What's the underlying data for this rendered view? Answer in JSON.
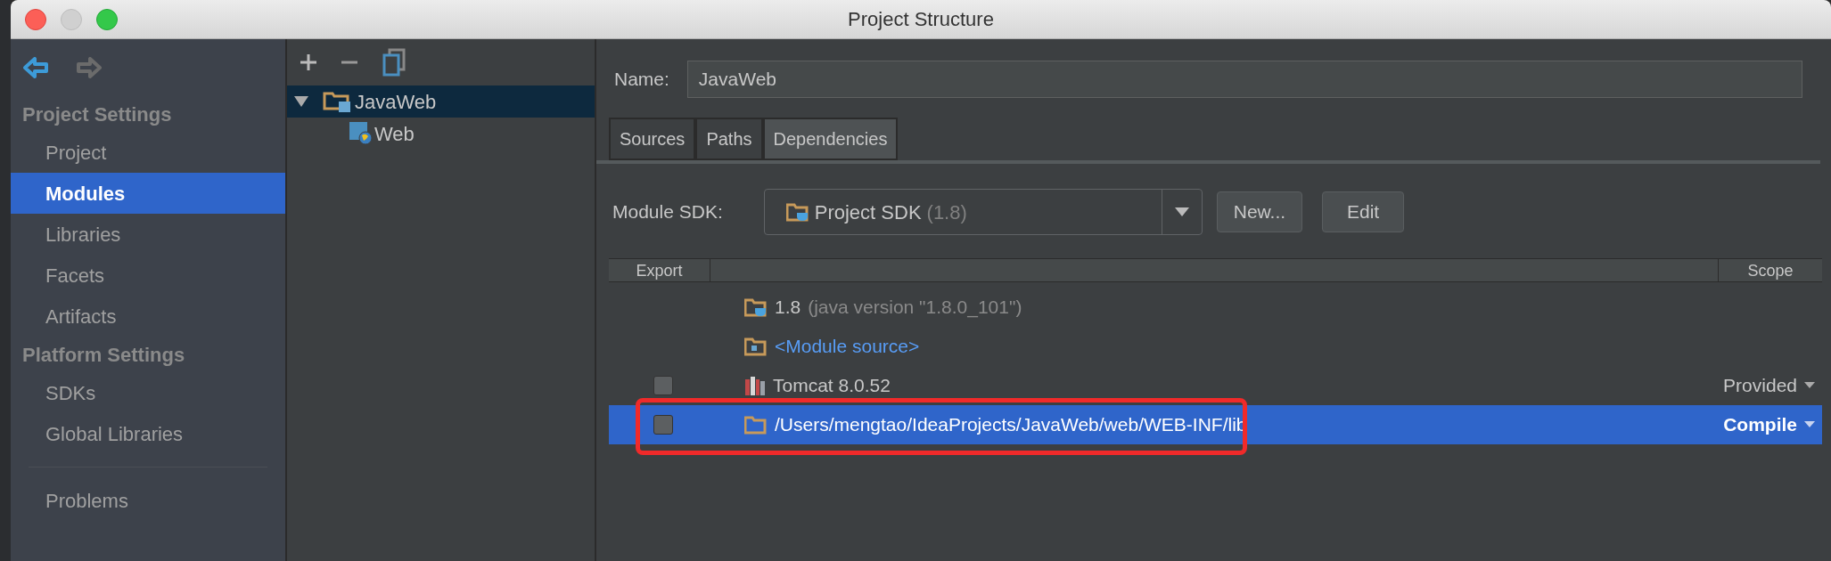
{
  "window": {
    "title": "Project Structure"
  },
  "sidebar": {
    "sections": [
      {
        "header": "Project Settings",
        "items": [
          {
            "label": "Project",
            "selected": false
          },
          {
            "label": "Modules",
            "selected": true
          },
          {
            "label": "Libraries",
            "selected": false
          },
          {
            "label": "Facets",
            "selected": false
          },
          {
            "label": "Artifacts",
            "selected": false
          }
        ]
      },
      {
        "header": "Platform Settings",
        "items": [
          {
            "label": "SDKs",
            "selected": false
          },
          {
            "label": "Global Libraries",
            "selected": false
          }
        ]
      }
    ],
    "footer_items": [
      {
        "label": "Problems",
        "selected": false
      }
    ]
  },
  "tree": [
    {
      "label": "JavaWeb",
      "kind": "module",
      "selected": true,
      "expanded": true,
      "children": [
        {
          "label": "Web",
          "kind": "web",
          "selected": false
        }
      ]
    }
  ],
  "name_field": {
    "label": "Name:",
    "value": "JavaWeb"
  },
  "tabs": [
    {
      "label": "Sources",
      "selected": false
    },
    {
      "label": "Paths",
      "selected": false
    },
    {
      "label": "Dependencies",
      "selected": true
    }
  ],
  "module_sdk": {
    "label": "Module SDK:",
    "value": "Project SDK",
    "detail": "(1.8)"
  },
  "buttons": [
    "New...",
    "Edit"
  ],
  "table": {
    "columns": [
      "Export",
      "Scope"
    ],
    "rows": [
      {
        "kind": "sdk",
        "name": "1.8",
        "detail": "(java version \"1.8.0_101\")",
        "selected": false
      },
      {
        "kind": "source",
        "name": "<Module source>",
        "selected": false
      },
      {
        "kind": "library",
        "name": "Tomcat 8.0.52",
        "checked": false,
        "scope": "Provided",
        "selected": false
      },
      {
        "kind": "folder",
        "name": "/Users/mengtao/IdeaProjects/JavaWeb/web/WEB-INF/lib",
        "checked": false,
        "scope": "Compile",
        "selected": true,
        "highlighted": true
      }
    ]
  }
}
